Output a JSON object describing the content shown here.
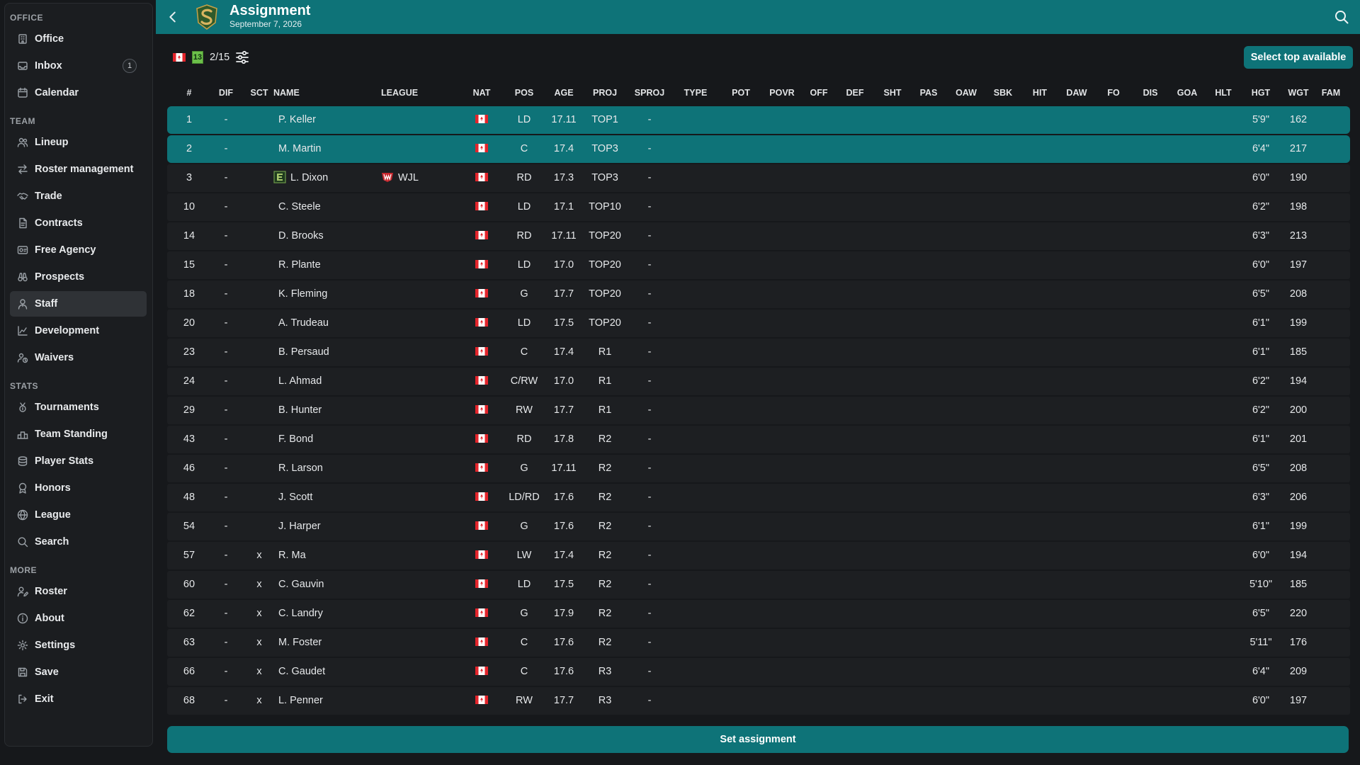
{
  "header": {
    "title": "Assignment",
    "date": "September 7, 2026",
    "brand_color": "#0e7378"
  },
  "sidebar": {
    "sections": [
      {
        "title": "OFFICE",
        "items": [
          {
            "label": "Office",
            "icon": "building-icon"
          },
          {
            "label": "Inbox",
            "icon": "inbox-icon",
            "badge": "1"
          },
          {
            "label": "Calendar",
            "icon": "calendar-icon"
          }
        ]
      },
      {
        "title": "TEAM",
        "items": [
          {
            "label": "Lineup",
            "icon": "users-icon"
          },
          {
            "label": "Roster management",
            "icon": "arrows-icon"
          },
          {
            "label": "Trade",
            "icon": "handshake-icon"
          },
          {
            "label": "Contracts",
            "icon": "contract-icon"
          },
          {
            "label": "Free Agency",
            "icon": "id-card-icon"
          },
          {
            "label": "Prospects",
            "icon": "binoculars-icon"
          },
          {
            "label": "Staff",
            "icon": "staff-icon",
            "active": true
          },
          {
            "label": "Development",
            "icon": "chart-line-icon"
          },
          {
            "label": "Waivers",
            "icon": "user-clock-icon"
          }
        ]
      },
      {
        "title": "STATS",
        "items": [
          {
            "label": "Tournaments",
            "icon": "medal-icon"
          },
          {
            "label": "Team Standing",
            "icon": "podium-icon"
          },
          {
            "label": "Player Stats",
            "icon": "database-icon"
          },
          {
            "label": "Honors",
            "icon": "award-icon"
          },
          {
            "label": "League",
            "icon": "globe-icon"
          },
          {
            "label": "Search",
            "icon": "search-icon"
          }
        ]
      },
      {
        "title": "MORE",
        "items": [
          {
            "label": "Roster",
            "icon": "user-edit-icon"
          },
          {
            "label": "About",
            "icon": "info-icon"
          },
          {
            "label": "Settings",
            "icon": "gear-icon"
          },
          {
            "label": "Save",
            "icon": "save-icon"
          },
          {
            "label": "Exit",
            "icon": "exit-icon"
          }
        ]
      }
    ]
  },
  "toolbar": {
    "rank": "13",
    "count": "2/15",
    "select_top_label": "Select top available"
  },
  "table": {
    "columns": [
      "#",
      "DIF",
      "SCT",
      "NAME",
      "LEAGUE",
      "NAT",
      "POS",
      "AGE",
      "PROJ",
      "SPROJ",
      "TYPE",
      "POT",
      "POVR",
      "OFF",
      "DEF",
      "SHT",
      "PAS",
      "OAW",
      "SBK",
      "HIT",
      "DAW",
      "FO",
      "DIS",
      "GOA",
      "HLT",
      "HGT",
      "WGT",
      "FAM"
    ],
    "rows": [
      {
        "num": "1",
        "dif": "-",
        "sct": "",
        "name": "P. Keller",
        "league": "",
        "pos": "LD",
        "age": "17.11",
        "proj": "TOP1",
        "sproj": "-",
        "hgt": "5'9\"",
        "wgt": "162",
        "selected": true
      },
      {
        "num": "2",
        "dif": "-",
        "sct": "",
        "name": "M. Martin",
        "league": "",
        "pos": "C",
        "age": "17.4",
        "proj": "TOP3",
        "sproj": "-",
        "hgt": "6'4\"",
        "wgt": "217",
        "selected": true
      },
      {
        "num": "3",
        "dif": "-",
        "sct": "",
        "name": "L. Dixon",
        "league": "WJL",
        "pos": "RD",
        "age": "17.3",
        "proj": "TOP3",
        "sproj": "-",
        "hgt": "6'0\"",
        "wgt": "190",
        "team_icon": "team-e-icon",
        "league_icon": "wjl-league-icon"
      },
      {
        "num": "10",
        "dif": "-",
        "sct": "",
        "name": "C. Steele",
        "league": "",
        "pos": "LD",
        "age": "17.1",
        "proj": "TOP10",
        "sproj": "-",
        "hgt": "6'2\"",
        "wgt": "198"
      },
      {
        "num": "14",
        "dif": "-",
        "sct": "",
        "name": "D. Brooks",
        "league": "",
        "pos": "RD",
        "age": "17.11",
        "proj": "TOP20",
        "sproj": "-",
        "hgt": "6'3\"",
        "wgt": "213"
      },
      {
        "num": "15",
        "dif": "-",
        "sct": "",
        "name": "R. Plante",
        "league": "",
        "pos": "LD",
        "age": "17.0",
        "proj": "TOP20",
        "sproj": "-",
        "hgt": "6'0\"",
        "wgt": "197"
      },
      {
        "num": "18",
        "dif": "-",
        "sct": "",
        "name": "K. Fleming",
        "league": "",
        "pos": "G",
        "age": "17.7",
        "proj": "TOP20",
        "sproj": "-",
        "hgt": "6'5\"",
        "wgt": "208"
      },
      {
        "num": "20",
        "dif": "-",
        "sct": "",
        "name": "A. Trudeau",
        "league": "",
        "pos": "LD",
        "age": "17.5",
        "proj": "TOP20",
        "sproj": "-",
        "hgt": "6'1\"",
        "wgt": "199"
      },
      {
        "num": "23",
        "dif": "-",
        "sct": "",
        "name": "B. Persaud",
        "league": "",
        "pos": "C",
        "age": "17.4",
        "proj": "R1",
        "sproj": "-",
        "hgt": "6'1\"",
        "wgt": "185"
      },
      {
        "num": "24",
        "dif": "-",
        "sct": "",
        "name": "L. Ahmad",
        "league": "",
        "pos": "C/RW",
        "age": "17.0",
        "proj": "R1",
        "sproj": "-",
        "hgt": "6'2\"",
        "wgt": "194"
      },
      {
        "num": "29",
        "dif": "-",
        "sct": "",
        "name": "B. Hunter",
        "league": "",
        "pos": "RW",
        "age": "17.7",
        "proj": "R1",
        "sproj": "-",
        "hgt": "6'2\"",
        "wgt": "200"
      },
      {
        "num": "43",
        "dif": "-",
        "sct": "",
        "name": "F. Bond",
        "league": "",
        "pos": "RD",
        "age": "17.8",
        "proj": "R2",
        "sproj": "-",
        "hgt": "6'1\"",
        "wgt": "201"
      },
      {
        "num": "46",
        "dif": "-",
        "sct": "",
        "name": "R. Larson",
        "league": "",
        "pos": "G",
        "age": "17.11",
        "proj": "R2",
        "sproj": "-",
        "hgt": "6'5\"",
        "wgt": "208"
      },
      {
        "num": "48",
        "dif": "-",
        "sct": "",
        "name": "J. Scott",
        "league": "",
        "pos": "LD/RD",
        "age": "17.6",
        "proj": "R2",
        "sproj": "-",
        "hgt": "6'3\"",
        "wgt": "206"
      },
      {
        "num": "54",
        "dif": "-",
        "sct": "",
        "name": "J. Harper",
        "league": "",
        "pos": "G",
        "age": "17.6",
        "proj": "R2",
        "sproj": "-",
        "hgt": "6'1\"",
        "wgt": "199"
      },
      {
        "num": "57",
        "dif": "-",
        "sct": "x",
        "name": "R. Ma",
        "league": "",
        "pos": "LW",
        "age": "17.4",
        "proj": "R2",
        "sproj": "-",
        "hgt": "6'0\"",
        "wgt": "194"
      },
      {
        "num": "60",
        "dif": "-",
        "sct": "x",
        "name": "C. Gauvin",
        "league": "",
        "pos": "LD",
        "age": "17.5",
        "proj": "R2",
        "sproj": "-",
        "hgt": "5'10\"",
        "wgt": "185"
      },
      {
        "num": "62",
        "dif": "-",
        "sct": "x",
        "name": "C. Landry",
        "league": "",
        "pos": "G",
        "age": "17.9",
        "proj": "R2",
        "sproj": "-",
        "hgt": "6'5\"",
        "wgt": "220"
      },
      {
        "num": "63",
        "dif": "-",
        "sct": "x",
        "name": "M. Foster",
        "league": "",
        "pos": "C",
        "age": "17.6",
        "proj": "R2",
        "sproj": "-",
        "hgt": "5'11\"",
        "wgt": "176"
      },
      {
        "num": "66",
        "dif": "-",
        "sct": "x",
        "name": "C. Gaudet",
        "league": "",
        "pos": "C",
        "age": "17.6",
        "proj": "R3",
        "sproj": "-",
        "hgt": "6'4\"",
        "wgt": "209"
      },
      {
        "num": "68",
        "dif": "-",
        "sct": "x",
        "name": "L. Penner",
        "league": "",
        "pos": "RW",
        "age": "17.7",
        "proj": "R3",
        "sproj": "-",
        "hgt": "6'0\"",
        "wgt": "197"
      }
    ]
  },
  "footer": {
    "set_assignment_label": "Set assignment"
  }
}
